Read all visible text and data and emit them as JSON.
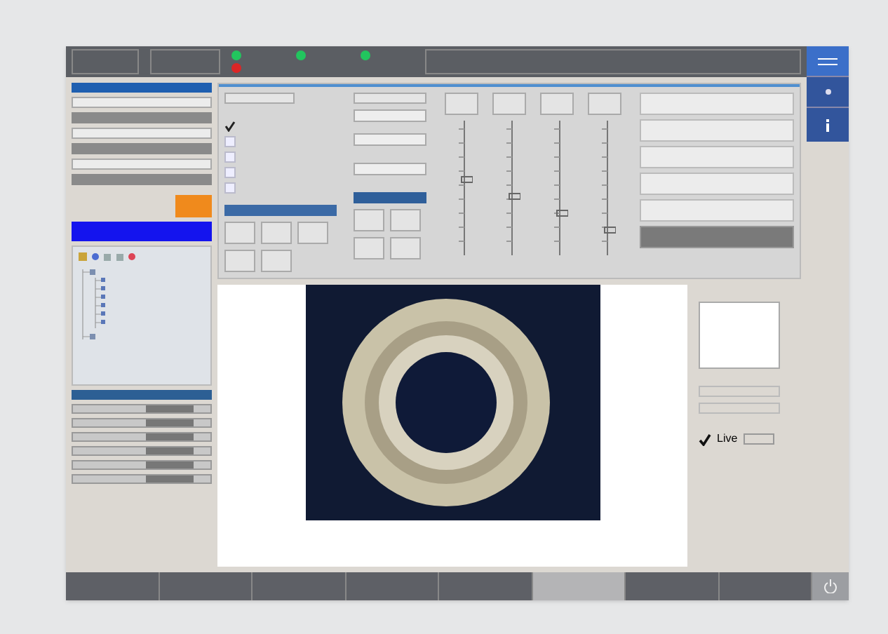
{
  "status_lights": [
    {
      "color": "#22c55e"
    },
    {
      "color": "#22c55e"
    },
    {
      "color": "#22c55e"
    },
    {
      "color": "#dc2626"
    }
  ],
  "settings_checkboxes": [
    {
      "checked": true
    },
    {
      "checked": false
    },
    {
      "checked": false
    },
    {
      "checked": false
    },
    {
      "checked": false
    }
  ],
  "live": {
    "label": "Live",
    "checked": true
  },
  "bottom_tabs": [
    {
      "selected": false
    },
    {
      "selected": false
    },
    {
      "selected": false
    },
    {
      "selected": false
    },
    {
      "selected": false
    },
    {
      "selected": true
    },
    {
      "selected": false
    },
    {
      "selected": false
    }
  ]
}
